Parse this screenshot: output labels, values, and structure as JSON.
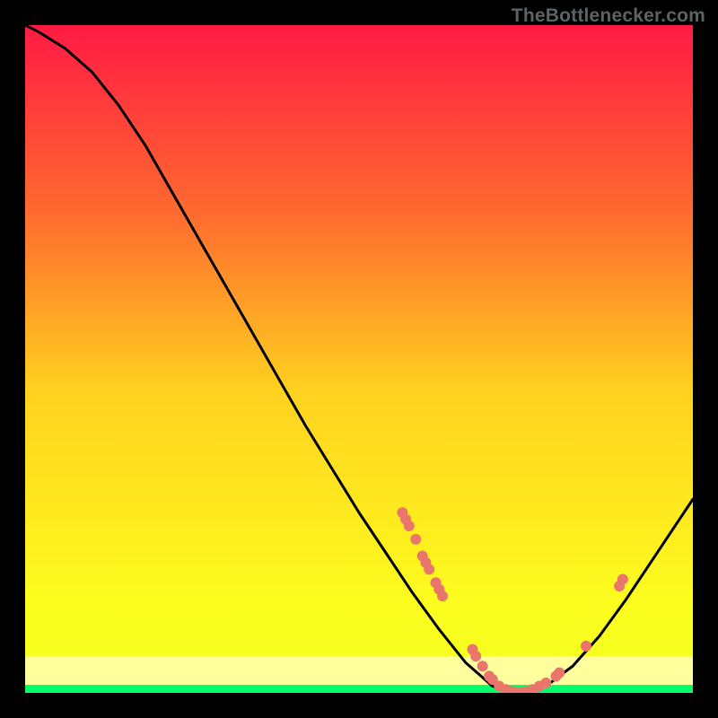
{
  "attribution": "TheBottlenecker.com",
  "chart_data": {
    "type": "line",
    "title": "",
    "xlabel": "",
    "ylabel": "",
    "xlim": [
      0,
      100
    ],
    "ylim": [
      0,
      100
    ],
    "grid": false,
    "legend": false,
    "background_gradient": {
      "top": "#ff1a44",
      "mid_upper": "#ff8a2a",
      "mid": "#ffe61f",
      "mid_lower": "#f7ff1f",
      "bottom_band": "#ffff9e",
      "bottom_line": "#00ff6a"
    },
    "series": [
      {
        "name": "bottleneck-curve",
        "x": [
          0,
          2,
          6,
          10,
          14,
          18,
          22,
          26,
          30,
          34,
          38,
          42,
          46,
          50,
          54,
          58,
          62,
          66,
          70,
          74,
          78,
          82,
          86,
          90,
          94,
          98,
          100
        ],
        "y": [
          100,
          99,
          96.5,
          93,
          88,
          82,
          75,
          68,
          61,
          54,
          47,
          40,
          33.5,
          27,
          21,
          15,
          9.5,
          4.5,
          1,
          0,
          1,
          4,
          8.5,
          14,
          20,
          26,
          29
        ]
      }
    ],
    "markers": [
      {
        "x": 56.5,
        "y": 27.0
      },
      {
        "x": 57.0,
        "y": 26.0
      },
      {
        "x": 57.5,
        "y": 25.0
      },
      {
        "x": 58.5,
        "y": 23.0
      },
      {
        "x": 59.5,
        "y": 20.5
      },
      {
        "x": 60.0,
        "y": 19.5
      },
      {
        "x": 60.5,
        "y": 18.5
      },
      {
        "x": 61.5,
        "y": 16.5
      },
      {
        "x": 62.0,
        "y": 15.5
      },
      {
        "x": 62.5,
        "y": 14.5
      },
      {
        "x": 67.0,
        "y": 6.5
      },
      {
        "x": 67.5,
        "y": 5.5
      },
      {
        "x": 68.5,
        "y": 4.0
      },
      {
        "x": 69.5,
        "y": 2.5
      },
      {
        "x": 70.0,
        "y": 2.0
      },
      {
        "x": 71.0,
        "y": 1.0
      },
      {
        "x": 72.0,
        "y": 0.5
      },
      {
        "x": 73.0,
        "y": 0.2
      },
      {
        "x": 74.0,
        "y": 0.0
      },
      {
        "x": 75.0,
        "y": 0.2
      },
      {
        "x": 76.0,
        "y": 0.5
      },
      {
        "x": 77.0,
        "y": 1.0
      },
      {
        "x": 78.0,
        "y": 1.5
      },
      {
        "x": 79.5,
        "y": 2.5
      },
      {
        "x": 80.0,
        "y": 3.0
      },
      {
        "x": 84.0,
        "y": 7.0
      },
      {
        "x": 89.0,
        "y": 16.0
      },
      {
        "x": 89.5,
        "y": 17.0
      }
    ],
    "marker_style": {
      "fill": "#e9756b",
      "radius": 6
    }
  }
}
